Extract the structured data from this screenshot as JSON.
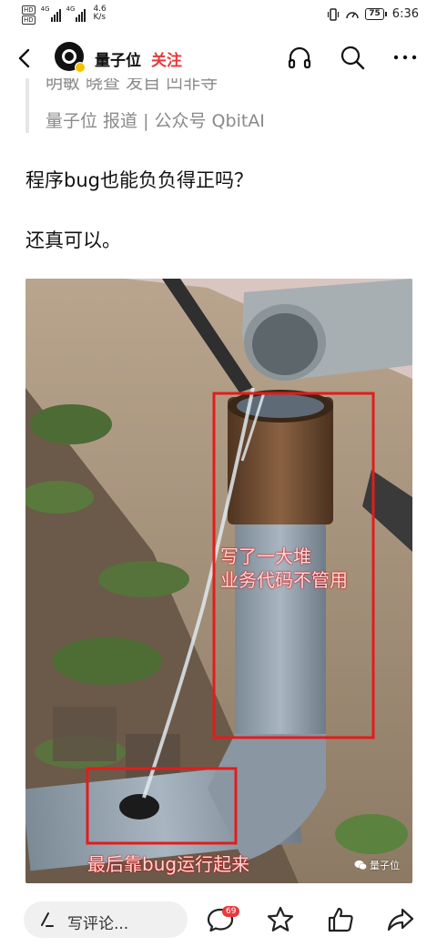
{
  "status_bar": {
    "sim1_tag": "HD",
    "sim2_tag": "HD",
    "sim1_network": "4G",
    "sim2_network": "4G",
    "net_speed_value": "4.6",
    "net_speed_unit": "K/s",
    "battery_level": "75",
    "time": "6:36"
  },
  "header": {
    "author_name": "量子位",
    "follow_label": "关注",
    "icons": [
      "back-icon",
      "headphones-icon",
      "search-icon",
      "more-icon"
    ]
  },
  "article": {
    "authors_line": "明敏 晓查 发自 凹非寺",
    "source_line": "量子位 报道 | 公众号 QbitAI",
    "paragraphs": [
      "程序bug也能负负得正吗？",
      "还真可以。"
    ],
    "image": {
      "caption_top_line1": "写了一大堆",
      "caption_top_line2": "业务代码不管用",
      "caption_bottom": "最后靠bug运行起来",
      "watermark": "量子位"
    }
  },
  "bottom_bar": {
    "comment_placeholder": "写评论...",
    "comment_count": "69",
    "icons": [
      "pen-icon",
      "comment-icon",
      "star-icon",
      "thumbs-up-icon",
      "share-icon"
    ]
  }
}
